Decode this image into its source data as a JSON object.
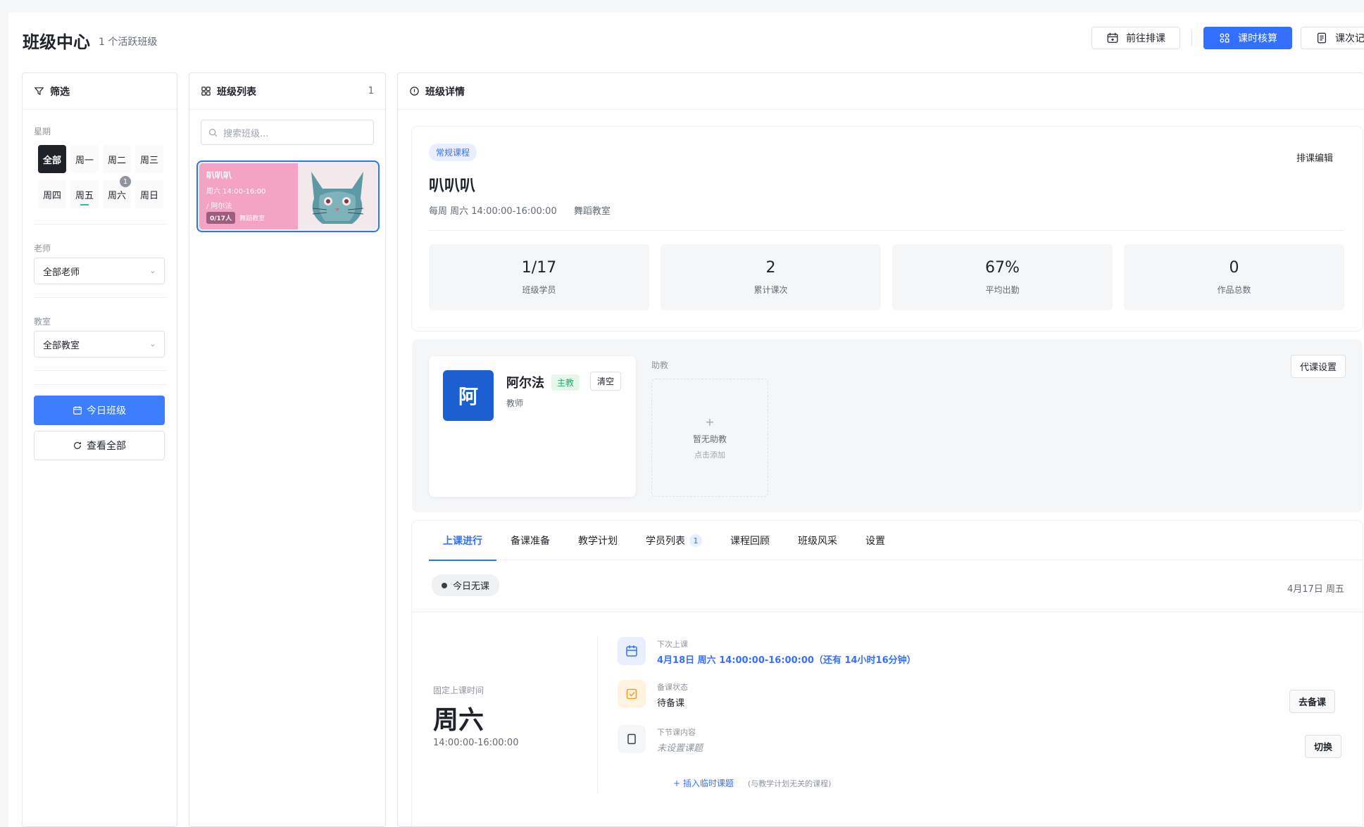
{
  "header": {
    "title": "班级中心",
    "subtitle": "1 个活跃班级",
    "actions": [
      {
        "label": "前往排课",
        "icon": "calendar-plus-icon"
      },
      {
        "label": "课时核算",
        "icon": "grid-icon"
      },
      {
        "label": "课次记录",
        "icon": "document-icon"
      }
    ]
  },
  "filter": {
    "title": "筛选",
    "weekday_label": "星期",
    "days": [
      "全部",
      "周一",
      "周二",
      "周三",
      "周四",
      "周五",
      "周六",
      "周日"
    ],
    "active_day": "全部",
    "saturday_badge": "1",
    "teacher_label": "老师",
    "teacher_value": "全部老师",
    "classroom_label": "教室",
    "classroom_value": "全部教室",
    "today_button": "今日班级",
    "all_button": "查看全部"
  },
  "class_list": {
    "title": "班级列表",
    "count": "1",
    "search_placeholder": "搜索班级...",
    "cards": [
      {
        "name": "叭叭叭",
        "time": "周六 14:00-16:00",
        "teacher": "/ 阿尔法",
        "students": "0/17人",
        "room": "舞蹈教室"
      }
    ]
  },
  "detail": {
    "title": "班级详情",
    "tag": "常规课程",
    "edit_schedule": "排课编辑",
    "class_name": "叭叭叭",
    "schedule": "每周 周六 14:00:00-16:00:00",
    "room": "舞蹈教室",
    "stats": [
      {
        "value": "1/17",
        "label": "班级学员"
      },
      {
        "value": "2",
        "label": "累计课次"
      },
      {
        "value": "67%",
        "label": "平均出勤"
      },
      {
        "value": "0",
        "label": "作品总数"
      }
    ],
    "teacher": {
      "avatar": "阿",
      "name": "阿尔法",
      "role": "主教",
      "clear": "清空",
      "title": "教师"
    },
    "assistant": {
      "label": "助教",
      "empty": "暂无助教",
      "hint": "点击添加",
      "plus": "+"
    },
    "substitute_button": "代课设置",
    "tabs": [
      {
        "label": "上课进行",
        "badge": null
      },
      {
        "label": "备课准备",
        "badge": null
      },
      {
        "label": "教学计划",
        "badge": null
      },
      {
        "label": "学员列表",
        "badge": "1"
      },
      {
        "label": "课程回顾",
        "badge": null
      },
      {
        "label": "班级风采",
        "badge": null
      },
      {
        "label": "设置",
        "badge": null
      }
    ],
    "status": "今日无课",
    "date": "4月17日 周五",
    "fixed_label": "固定上课时间",
    "fixed_day": "周六",
    "fixed_time": "14:00:00-16:00:00",
    "next_class_label": "下次上课",
    "next_class_value": "4月18日 周六 14:00:00-16:00:00（还有 14小时16分钟）",
    "prep_label": "备课状态",
    "prep_value": "待备课",
    "prep_button": "去备课",
    "next_content_label": "下节课内容",
    "next_content_value": "未设置课题",
    "switch_button": "切换",
    "insert_link": "+ 插入临时课题",
    "insert_note": "(与教学计划无关的课程)"
  },
  "colors": {
    "primary": "#3370ff",
    "card_pink": "#f4a2c6",
    "avatar_blue": "#1b5fd1",
    "success": "#2ba471"
  }
}
